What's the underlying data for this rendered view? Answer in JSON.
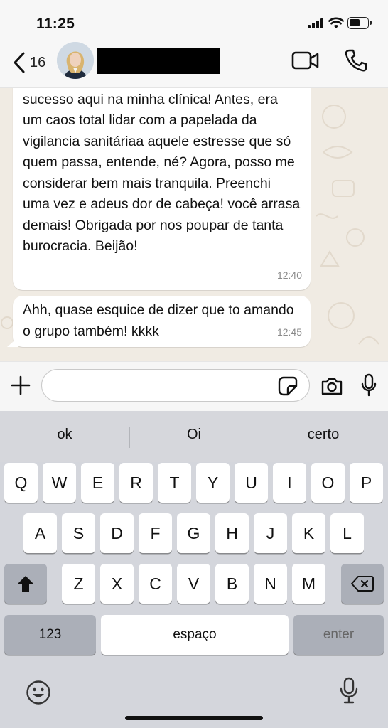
{
  "status_bar": {
    "time": "11:25",
    "icons": [
      "signal-icon",
      "wifi-icon",
      "battery-icon"
    ]
  },
  "header": {
    "back_count": "16",
    "contact_name": "",
    "icons": [
      "back-chevron-icon",
      "video-call-icon",
      "phone-icon"
    ]
  },
  "messages": [
    {
      "text": "Oiha, só tenho elogios pro Safe Clinic, foi só sucesso aqui na minha clínica! Antes, era um caos total lidar com a papelada da vigilancia sanitáriaa aquele estresse que só quem passa, entende, né? Agora, posso me considerar bem mais tranquila. Preenchi uma vez e adeus dor de cabeça! você arrasa demais! Obrigada por nos poupar de tanta burocracia. Beijão!",
      "time": "12:40"
    },
    {
      "text": "Ahh, quase esquice de dizer que to amando o grupo também! kkkk",
      "time": "12:45"
    }
  ],
  "input": {
    "value": "",
    "placeholder": ""
  },
  "keyboard": {
    "suggestions": [
      "ok",
      "Oi",
      "certo"
    ],
    "row1": [
      "Q",
      "W",
      "E",
      "R",
      "T",
      "Y",
      "U",
      "I",
      "O",
      "P"
    ],
    "row2": [
      "A",
      "S",
      "D",
      "F",
      "G",
      "H",
      "J",
      "K",
      "L"
    ],
    "row3": [
      "Z",
      "X",
      "C",
      "V",
      "B",
      "N",
      "M"
    ],
    "numbers_label": "123",
    "space_label": "espaço",
    "enter_label": "enter"
  },
  "colors": {
    "chat_background": "#f0ebe3",
    "bubble": "#ffffff",
    "keyboard": "#d4d6dc",
    "text": "#111111"
  }
}
